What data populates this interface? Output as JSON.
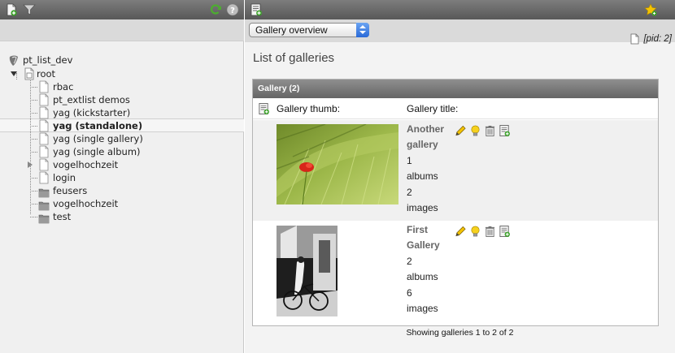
{
  "tree": {
    "root_site": "pt_list_dev",
    "root_page": "root",
    "items": [
      {
        "label": "rbac",
        "type": "page"
      },
      {
        "label": "pt_extlist demos",
        "type": "page"
      },
      {
        "label": "yag (kickstarter)",
        "type": "page"
      },
      {
        "label": "yag (standalone)",
        "type": "page",
        "selected": true
      },
      {
        "label": "yag (single gallery)",
        "type": "page"
      },
      {
        "label": "yag (single album)",
        "type": "page"
      },
      {
        "label": "vogelhochzeit",
        "type": "page",
        "collapsed": true
      },
      {
        "label": "login",
        "type": "page"
      },
      {
        "label": "feusers",
        "type": "folder"
      },
      {
        "label": "vogelhochzeit",
        "type": "folder"
      },
      {
        "label": "test",
        "type": "folder"
      }
    ]
  },
  "header": {
    "view_select_value": "Gallery overview",
    "pid_label": "[pid: 2]"
  },
  "main": {
    "title": "List of galleries",
    "table_header": "Gallery (2)",
    "col_thumb": "Gallery thumb:",
    "col_title": "Gallery title:",
    "galleries": [
      {
        "name_line1": "Another",
        "name_line2": "gallery",
        "albums_count": "1",
        "albums_label": "albums",
        "images_count": "2",
        "images_label": "images"
      },
      {
        "name_line1": "First",
        "name_line2": "Gallery",
        "albums_count": "2",
        "albums_label": "albums",
        "images_count": "6",
        "images_label": "images"
      }
    ],
    "footer": "Showing galleries 1 to 2 of 2"
  },
  "icons": {
    "new_page": "new-page-icon",
    "filter": "filter-icon",
    "refresh": "refresh-icon",
    "help": "help-icon",
    "edit_list": "edit-list-icon",
    "bookmark": "bookmark-star-icon"
  },
  "colors": {
    "toolbar": "#6a6a6a",
    "table_header": "#7a7a7a",
    "gallery_name": "#666666"
  }
}
